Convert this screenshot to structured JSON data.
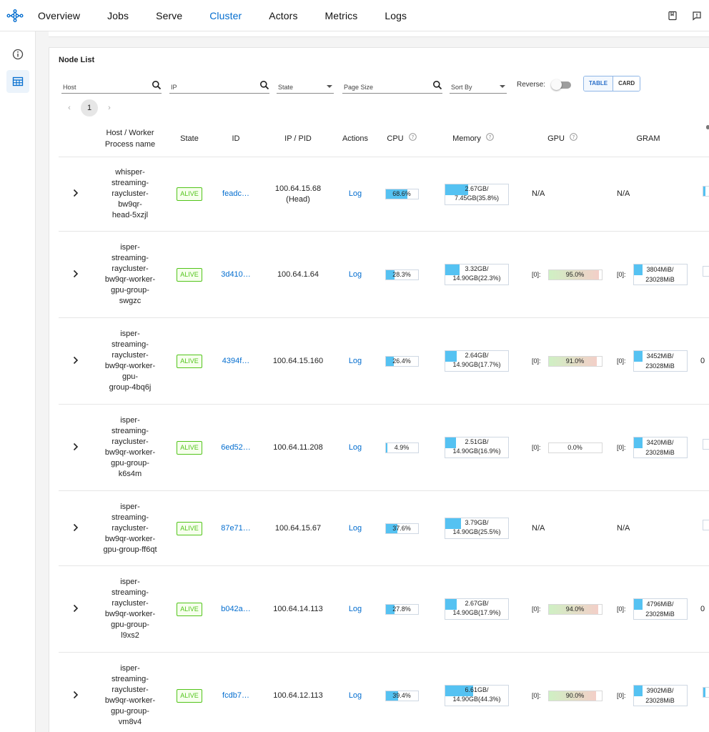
{
  "nav": [
    "Overview",
    "Jobs",
    "Serve",
    "Cluster",
    "Actors",
    "Metrics",
    "Logs"
  ],
  "nav_active": "Cluster",
  "colors": {
    "accent": "#036dcf",
    "alive": "#52c41a",
    "bar": "#55c2f2"
  },
  "panel": {
    "title": "Node List"
  },
  "filters": {
    "host": "Host",
    "ip": "IP",
    "state": "State",
    "page_size": "Page Size",
    "sort_by": "Sort By",
    "reverse": "Reverse:",
    "table": "TABLE",
    "card": "CARD"
  },
  "pager": {
    "prev": "‹",
    "page": "1",
    "next": "›"
  },
  "columns": {
    "host": "Host / Worker Process name",
    "state": "State",
    "id": "ID",
    "ip": "IP / PID",
    "actions": "Actions",
    "cpu": "CPU",
    "memory": "Memory",
    "gpu": "GPU",
    "gram": "GRAM"
  },
  "rows": [
    {
      "host": "whisper-streaming-raycluster-bw9qr-head-5xzjl",
      "host_lines": [
        "whisper-",
        "streaming-",
        "raycluster-",
        "bw9qr-",
        "head-5xzjl"
      ],
      "state": "ALIVE",
      "id": "feadc…",
      "ip": "100.64.15.68",
      "ip_sub": "(Head)",
      "action": "Log",
      "cpu": "68.6%",
      "cpu_pct": 68.6,
      "mem_used": "2.67GB/",
      "mem_total": "7.45GB(35.8%)",
      "mem_pct": 35.8,
      "gpu": "N/A",
      "gpu_prefix": "",
      "gpu_pct": null,
      "gram": "N/A",
      "gram_prefix": "",
      "gram_used": "",
      "gram_total": "",
      "extra": "",
      "stub": true
    },
    {
      "host": "isper-streaming-raycluster-bw9qr-worker-gpu-group-swgzc",
      "host_lines": [
        "isper-",
        "streaming-",
        "raycluster-",
        "bw9qr-worker-",
        "gpu-group-",
        "swgzc"
      ],
      "state": "ALIVE",
      "id": "3d410…",
      "ip": "100.64.1.64",
      "ip_sub": "",
      "action": "Log",
      "cpu": "28.3%",
      "cpu_pct": 28.3,
      "mem_used": "3.32GB/",
      "mem_total": "14.90GB(22.3%)",
      "mem_pct": 22.3,
      "gpu": "95.0%",
      "gpu_prefix": "[0]:",
      "gpu_pct": 95,
      "gram": "",
      "gram_prefix": "[0]:",
      "gram_used": "3804MiB/",
      "gram_total": "23028MiB",
      "extra": "",
      "stub": false
    },
    {
      "host": "isper-streaming-raycluster-bw9qr-worker-gpu-group-4bq6j",
      "host_lines": [
        "isper-",
        "streaming-",
        "raycluster-",
        "bw9qr-worker-",
        "gpu-",
        "group-4bq6j"
      ],
      "state": "ALIVE",
      "id": "4394f…",
      "ip": "100.64.15.160",
      "ip_sub": "",
      "action": "Log",
      "cpu": "26.4%",
      "cpu_pct": 26.4,
      "mem_used": "2.64GB/",
      "mem_total": "14.90GB(17.7%)",
      "mem_pct": 17.7,
      "gpu": "91.0%",
      "gpu_prefix": "[0]:",
      "gpu_pct": 91,
      "gram": "",
      "gram_prefix": "[0]:",
      "gram_used": "3452MiB/",
      "gram_total": "23028MiB",
      "extra": "0",
      "stub": false
    },
    {
      "host": "isper-streaming-raycluster-bw9qr-worker-gpu-group-k6s4m",
      "host_lines": [
        "isper-",
        "streaming-",
        "raycluster-",
        "bw9qr-worker-",
        "gpu-group-",
        "k6s4m"
      ],
      "state": "ALIVE",
      "id": "6ed52…",
      "ip": "100.64.11.208",
      "ip_sub": "",
      "action": "Log",
      "cpu": "4.9%",
      "cpu_pct": 4.9,
      "mem_used": "2.51GB/",
      "mem_total": "14.90GB(16.9%)",
      "mem_pct": 16.9,
      "gpu": "0.0%",
      "gpu_prefix": "[0]:",
      "gpu_pct": 0,
      "gram": "",
      "gram_prefix": "[0]:",
      "gram_used": "3420MiB/",
      "gram_total": "23028MiB",
      "extra": "",
      "stub": false
    },
    {
      "host": "isper-streaming-raycluster-bw9qr-worker-gpu-group-ff6qt",
      "host_lines": [
        "isper-",
        "streaming-",
        "raycluster-",
        "bw9qr-worker-",
        "gpu-group-ff6qt"
      ],
      "state": "ALIVE",
      "id": "87e71…",
      "ip": "100.64.15.67",
      "ip_sub": "",
      "action": "Log",
      "cpu": "37.6%",
      "cpu_pct": 37.6,
      "mem_used": "3.79GB/",
      "mem_total": "14.90GB(25.5%)",
      "mem_pct": 25.5,
      "gpu": "N/A",
      "gpu_prefix": "",
      "gpu_pct": null,
      "gram": "N/A",
      "gram_prefix": "",
      "gram_used": "",
      "gram_total": "",
      "extra": "",
      "stub": false
    },
    {
      "host": "isper-streaming-raycluster-bw9qr-worker-gpu-group-l9xs2",
      "host_lines": [
        "isper-",
        "streaming-",
        "raycluster-",
        "bw9qr-worker-",
        "gpu-group-",
        "l9xs2"
      ],
      "state": "ALIVE",
      "id": "b042a…",
      "ip": "100.64.14.113",
      "ip_sub": "",
      "action": "Log",
      "cpu": "27.8%",
      "cpu_pct": 27.8,
      "mem_used": "2.67GB/",
      "mem_total": "14.90GB(17.9%)",
      "mem_pct": 17.9,
      "gpu": "94.0%",
      "gpu_prefix": "[0]:",
      "gpu_pct": 94,
      "gram": "",
      "gram_prefix": "[0]:",
      "gram_used": "4796MiB/",
      "gram_total": "23028MiB",
      "extra": "0",
      "stub": false
    },
    {
      "host": "isper-streaming-raycluster-bw9qr-worker-gpu-group-vm8v4",
      "host_lines": [
        "isper-",
        "streaming-",
        "raycluster-",
        "bw9qr-worker-",
        "gpu-group-",
        "vm8v4"
      ],
      "state": "ALIVE",
      "id": "fcdb7…",
      "ip": "100.64.12.113",
      "ip_sub": "",
      "action": "Log",
      "cpu": "39.4%",
      "cpu_pct": 39.4,
      "mem_used": "6.61GB/",
      "mem_total": "14.90GB(44.3%)",
      "mem_pct": 44.3,
      "gpu": "90.0%",
      "gpu_prefix": "[0]:",
      "gpu_pct": 90,
      "gram": "",
      "gram_prefix": "[0]:",
      "gram_used": "3902MiB/",
      "gram_total": "23028MiB",
      "extra": "",
      "stub": true
    }
  ]
}
